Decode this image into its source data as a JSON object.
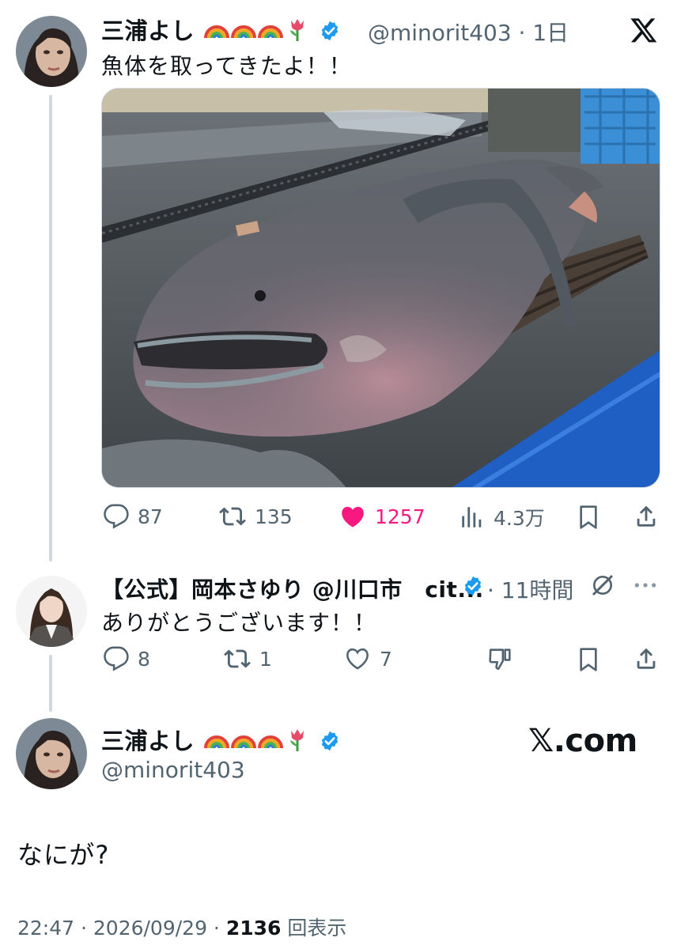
{
  "post1": {
    "display_name": "三浦よし",
    "emoji": [
      "rainbow-emoji",
      "rainbow-emoji",
      "rainbow-emoji",
      "tulip-emoji"
    ],
    "handle_time": "@minorit403 · 1日",
    "text": "魚体を取ってきたよ！！",
    "actions": {
      "replies": "87",
      "reposts": "135",
      "likes": "1257",
      "views": "4.3万"
    }
  },
  "post2": {
    "display_name": "【公式】岡本さゆり @川口市　cit...",
    "time": "· 11時間",
    "text": "ありがとうございます！！",
    "actions": {
      "replies": "8",
      "reposts": "1",
      "likes": "7"
    }
  },
  "post3": {
    "display_name": "三浦よし",
    "emoji": [
      "rainbow-emoji",
      "rainbow-emoji",
      "rainbow-emoji",
      "tulip-emoji"
    ],
    "handle": "@minorit403",
    "text": "なにが?",
    "meta_prefix": "22:47 · 2026/09/29 · ",
    "view_count": "2136",
    "views_label": "回表示"
  },
  "brand": {
    "watermark": "𝕏.com"
  },
  "colors": {
    "accent_blue": "#1d9bf0",
    "like_pink": "#f91880",
    "muted": "#536471",
    "thread_line": "#cfd9de"
  }
}
